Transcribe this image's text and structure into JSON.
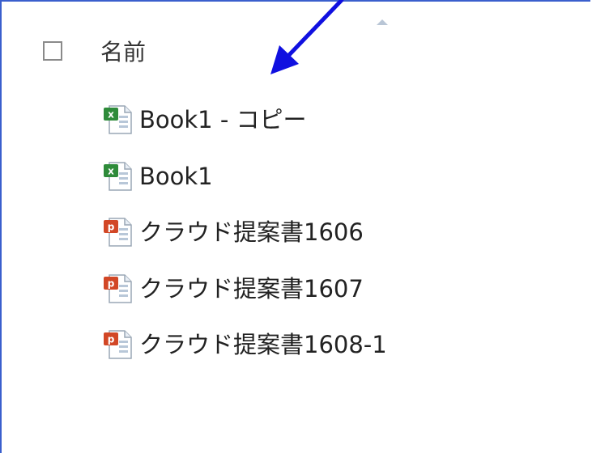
{
  "header": {
    "column_name": "名前"
  },
  "files": [
    {
      "name": "Book1 - コピー",
      "type": "excel",
      "icon": "excel-file-icon"
    },
    {
      "name": "Book1",
      "type": "excel",
      "icon": "excel-file-icon"
    },
    {
      "name": "クラウド提案書1606",
      "type": "powerpoint",
      "icon": "powerpoint-file-icon"
    },
    {
      "name": "クラウド提案書1607",
      "type": "powerpoint",
      "icon": "powerpoint-file-icon"
    },
    {
      "name": "クラウド提案書1608-1",
      "type": "powerpoint",
      "icon": "powerpoint-file-icon"
    }
  ],
  "colors": {
    "frame_border": "#3a5fcd",
    "annotation_arrow": "#1010e0",
    "excel_green": "#2e8b3a",
    "powerpoint_red": "#d24726"
  }
}
